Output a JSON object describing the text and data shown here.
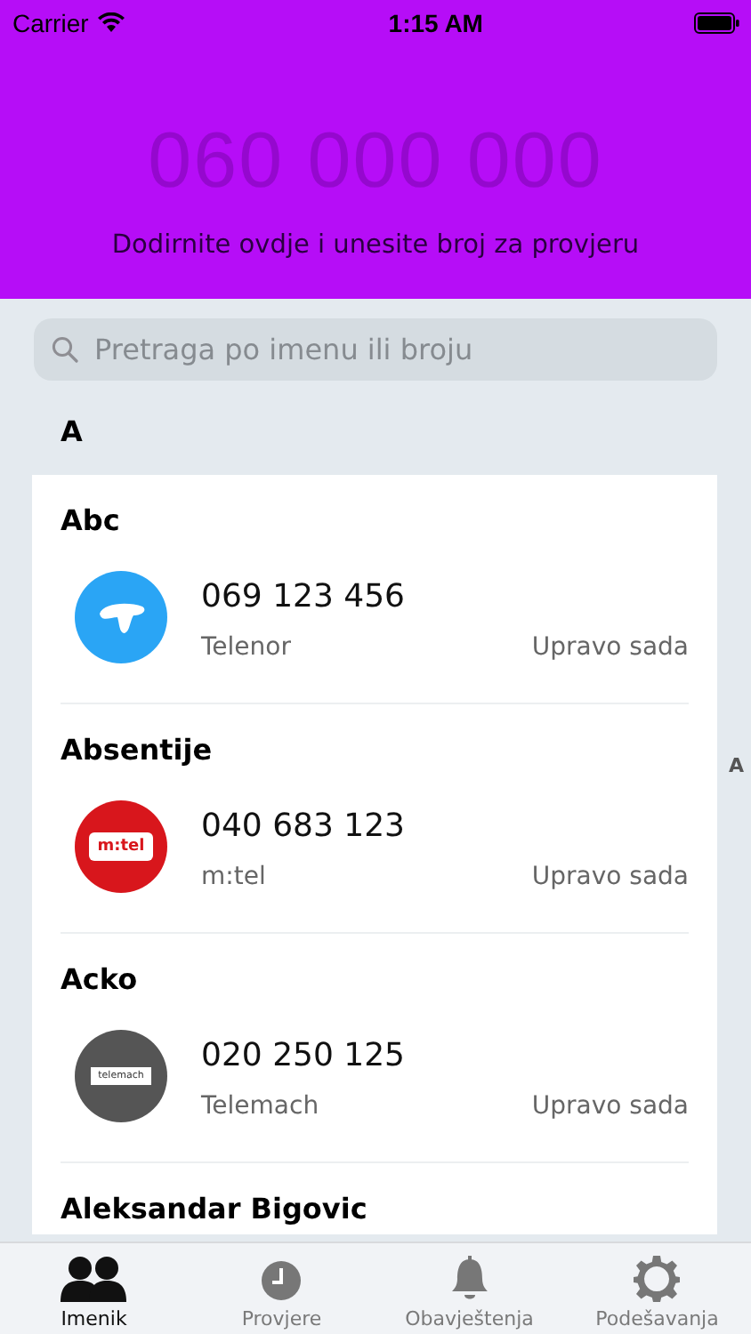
{
  "status_bar": {
    "carrier": "Carrier",
    "time": "1:15 AM"
  },
  "header": {
    "number_placeholder": "060 000 000",
    "hint": "Dodirnite ovdje i unesite broj za provjeru"
  },
  "search": {
    "placeholder": "Pretraga po imenu ili broju"
  },
  "section": "A",
  "index": [
    "A"
  ],
  "contacts": [
    {
      "name": "Abc",
      "number": "069 123 456",
      "operator": "Telenor",
      "time": "Upravo sada",
      "logo": {
        "kind": "drop",
        "color": "#2aa5f5"
      }
    },
    {
      "name": "Absentije",
      "number": "040 683 123",
      "operator": "m:tel",
      "time": "Upravo sada",
      "logo": {
        "kind": "tag",
        "color": "#d8161c",
        "text": "m:tel"
      }
    },
    {
      "name": "Acko",
      "number": "020 250 125",
      "operator": "Telemach",
      "time": "Upravo sada",
      "logo": {
        "kind": "plate",
        "color": "#555555",
        "text": "telemach"
      }
    },
    {
      "name": "Aleksandar Bigovic"
    }
  ],
  "tabs": [
    {
      "label": "Imenik",
      "kind": "people",
      "selected": true
    },
    {
      "label": "Provjere",
      "kind": "clock",
      "selected": false
    },
    {
      "label": "Obavještenja",
      "kind": "bell",
      "selected": false
    },
    {
      "label": "Podešavanja",
      "kind": "gear",
      "selected": false
    }
  ]
}
